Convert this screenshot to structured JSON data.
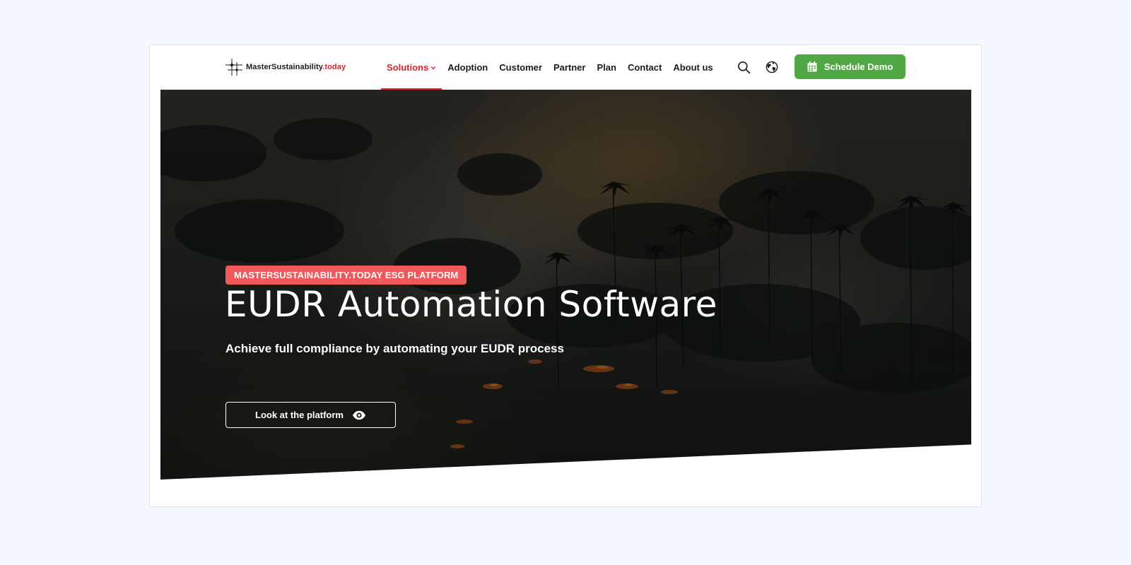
{
  "header": {
    "logo": {
      "text_main": "MasterSustainability",
      "text_accent": ".today",
      "icon": "sparkle-logo-icon"
    },
    "nav": [
      {
        "label": "Solutions",
        "active": true,
        "has_dropdown": true
      },
      {
        "label": "Adoption"
      },
      {
        "label": "Customer"
      },
      {
        "label": "Partner"
      },
      {
        "label": "Plan"
      },
      {
        "label": "Contact"
      },
      {
        "label": "About us"
      }
    ],
    "search_icon": "search-icon",
    "language_icon": "globe-icon",
    "cta": {
      "label": "Schedule Demo",
      "icon": "calendar-icon"
    }
  },
  "hero": {
    "badge": "MASTERSUSTAINABILITY.TODAY ESG PLATFORM",
    "title": "EUDR Automation Software",
    "subtitle": "Achieve full compliance by automating your EUDR process",
    "cta": {
      "label": "Look at the platform",
      "icon": "eye-icon"
    }
  },
  "colors": {
    "accent_red": "#e0212a",
    "badge_red": "#f0585c",
    "cta_green": "#4fa844",
    "page_bg": "#f3f7fe"
  }
}
